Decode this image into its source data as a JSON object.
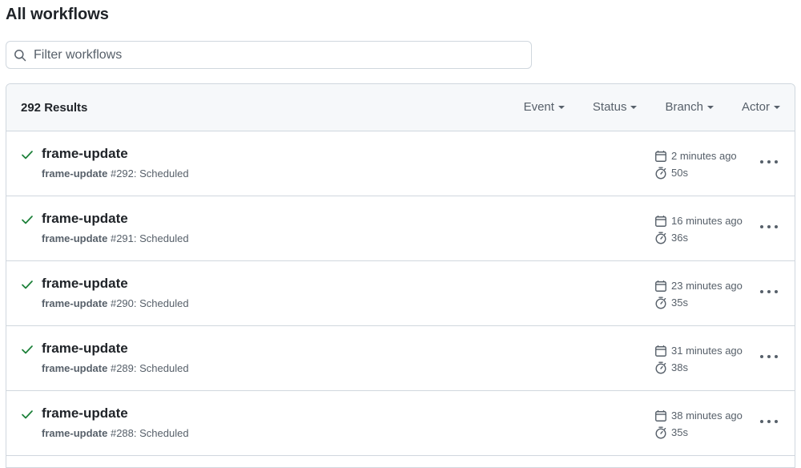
{
  "page": {
    "title": "All workflows"
  },
  "filter": {
    "placeholder": "Filter workflows",
    "value": ""
  },
  "header": {
    "results": "292 Results",
    "menus": [
      "Event",
      "Status",
      "Branch",
      "Actor"
    ]
  },
  "runs": [
    {
      "title": "frame-update",
      "workflow": "frame-update",
      "meta": " #292: Scheduled",
      "time": "2 minutes ago",
      "duration": "50s",
      "status": "success"
    },
    {
      "title": "frame-update",
      "workflow": "frame-update",
      "meta": " #291: Scheduled",
      "time": "16 minutes ago",
      "duration": "36s",
      "status": "success"
    },
    {
      "title": "frame-update",
      "workflow": "frame-update",
      "meta": " #290: Scheduled",
      "time": "23 minutes ago",
      "duration": "35s",
      "status": "success"
    },
    {
      "title": "frame-update",
      "workflow": "frame-update",
      "meta": " #289: Scheduled",
      "time": "31 minutes ago",
      "duration": "38s",
      "status": "success"
    },
    {
      "title": "frame-update",
      "workflow": "frame-update",
      "meta": " #288: Scheduled",
      "time": "38 minutes ago",
      "duration": "35s",
      "status": "success"
    }
  ],
  "colors": {
    "success": "#1a7f37",
    "muted": "#57606a",
    "border": "#d0d7de",
    "header_bg": "#f6f8fa"
  },
  "icons": {
    "search": "search-icon",
    "check": "check-icon",
    "calendar": "calendar-icon",
    "stopwatch": "stopwatch-icon",
    "more": "kebab-horizontal-icon"
  }
}
